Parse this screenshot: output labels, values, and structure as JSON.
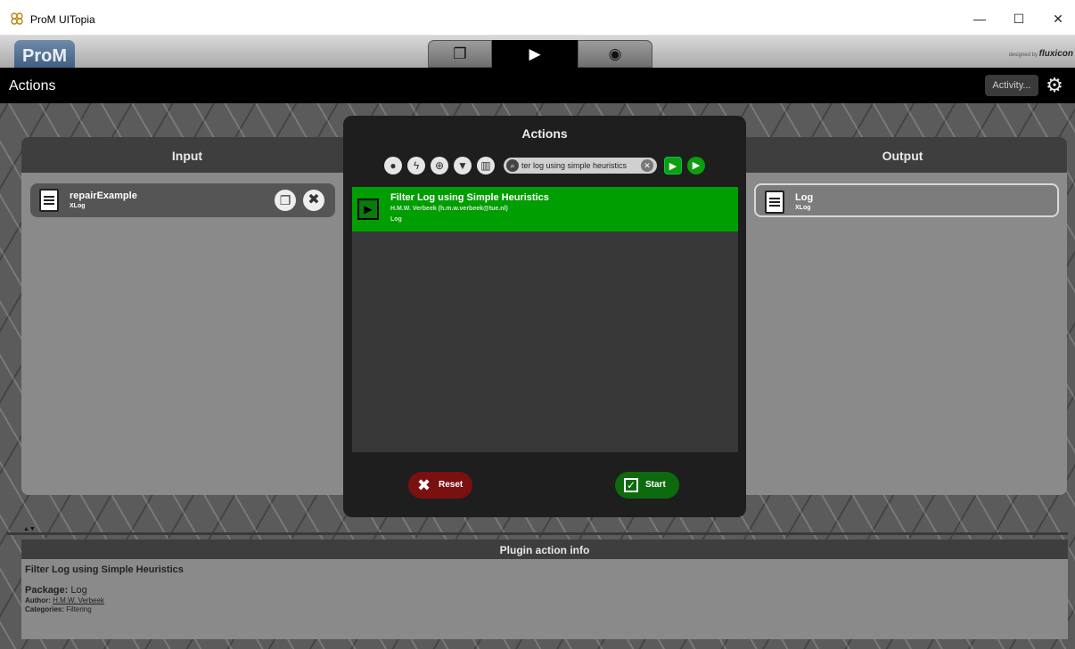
{
  "window": {
    "title": "ProM UITopia",
    "minimize_glyph": "—",
    "maximize_glyph": "☐",
    "close_glyph": "✕"
  },
  "header": {
    "logo": "ProM",
    "tabs": [
      {
        "name": "workspace",
        "icon": "documents-icon",
        "glyph": "❐",
        "active": false
      },
      {
        "name": "actions",
        "icon": "play-icon",
        "glyph": "▶",
        "active": true
      },
      {
        "name": "view",
        "icon": "eye-icon",
        "glyph": "◉",
        "active": false
      }
    ],
    "designed_by": "designed by",
    "brand": "fluxicon"
  },
  "actions_bar": {
    "heading": "Actions",
    "activity_label": "Activity..."
  },
  "input_panel": {
    "title": "Input",
    "items": [
      {
        "name": "repairExample",
        "type": "XLog"
      }
    ]
  },
  "output_panel": {
    "title": "Output",
    "items": [
      {
        "name": "Log",
        "type": "XLog"
      }
    ]
  },
  "dialog": {
    "title": "Actions",
    "filter_icons": [
      "lightbulb-icon",
      "bolt-icon",
      "plus-circle-icon",
      "funnel-icon",
      "chart-icon"
    ],
    "search_value": "ter log using simple heuristics",
    "search_clear_glyph": "✕",
    "actions": [
      {
        "name": "Filter Log using Simple Heuristics",
        "author": "H.M.W. Verbeek (h.m.w.verbeek@tue.nl)",
        "package": "Log",
        "selected": true
      }
    ],
    "reset_label": "Reset",
    "start_label": "Start"
  },
  "info_panel": {
    "title": "Plugin action info",
    "plugin_name": "Filter Log using Simple Heuristics",
    "package_label": "Package:",
    "package_value": "Log",
    "author_label": "Author:",
    "author_value": "H.M.W. Verbeek",
    "categories_label": "Categories:",
    "categories_value": "Filtering"
  },
  "colors": {
    "accent_green": "#019e01",
    "reset_red": "#7a1010",
    "panel_gray": "#8a8a8a",
    "header_dark": "#3e3e3e"
  }
}
